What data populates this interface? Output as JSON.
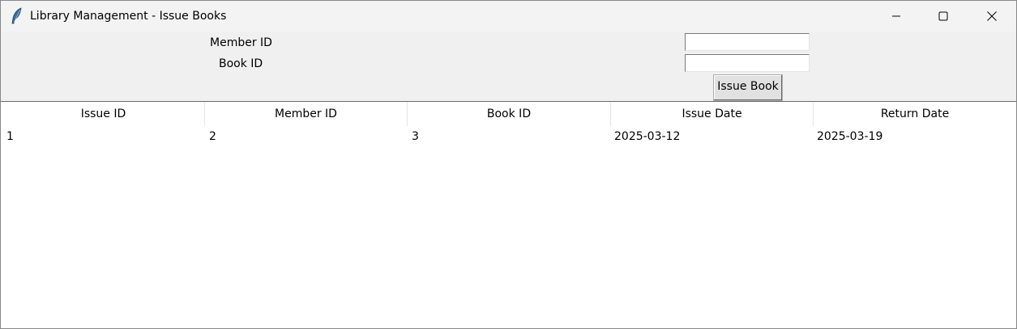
{
  "window": {
    "title": "Library Management - Issue Books",
    "icon": "feather-icon",
    "controls": [
      "minimize-icon",
      "maximize-icon",
      "close-icon"
    ]
  },
  "form": {
    "member_id_label": "Member ID",
    "book_id_label": "Book ID",
    "member_id_value": "",
    "book_id_value": "",
    "issue_button_label": "Issue Book"
  },
  "table": {
    "columns": [
      "Issue ID",
      "Member ID",
      "Book ID",
      "Issue Date",
      "Return Date"
    ],
    "rows": [
      [
        "1",
        "2",
        "3",
        "2025-03-12",
        "2025-03-19"
      ]
    ]
  }
}
